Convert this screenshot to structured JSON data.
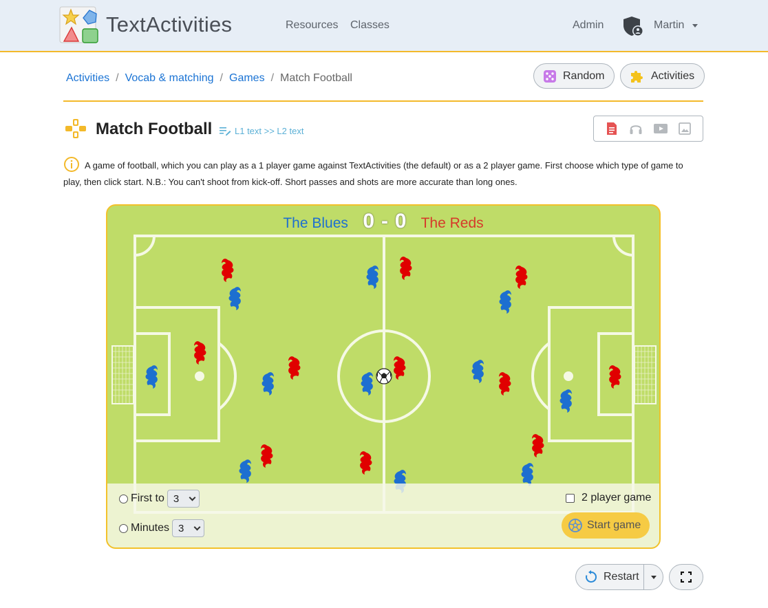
{
  "navbar": {
    "brand": "TextActivities",
    "links": [
      "Resources",
      "Classes"
    ],
    "admin": "Admin",
    "user": "Martin"
  },
  "breadcrumb": {
    "items": [
      "Activities",
      "Vocab & matching",
      "Games"
    ],
    "current": "Match Football"
  },
  "actions": {
    "random": "Random",
    "activities": "Activities"
  },
  "page": {
    "title": "Match Football",
    "mode": "L1 text >> L2 text",
    "description": "A game of football, which you can play as a 1 player game against TextActivities (the default) or as a 2 player game. First choose which type of game to play, then click start. N.B.: You can't shoot from kick-off. Short passes and shots are more accurate than long ones."
  },
  "media_icons": [
    "text-icon",
    "headphones-icon",
    "video-icon",
    "image-icon"
  ],
  "game": {
    "team_left": "The Blues",
    "team_right": "The Reds",
    "score_left": "0",
    "score_sep": "-",
    "score_right": "0",
    "first_to_label": "First to",
    "first_to_value": "3",
    "minutes_label": "Minutes",
    "minutes_value": "3",
    "two_player_label": "2 player game",
    "start_label": "Start game"
  },
  "bottom": {
    "restart": "Restart"
  },
  "colors": {
    "pitch": "#bfdc68",
    "blue_team": "#1d6fd0",
    "red_team": "#e00000",
    "accent": "#f3b92a",
    "link": "#1a73d4"
  }
}
